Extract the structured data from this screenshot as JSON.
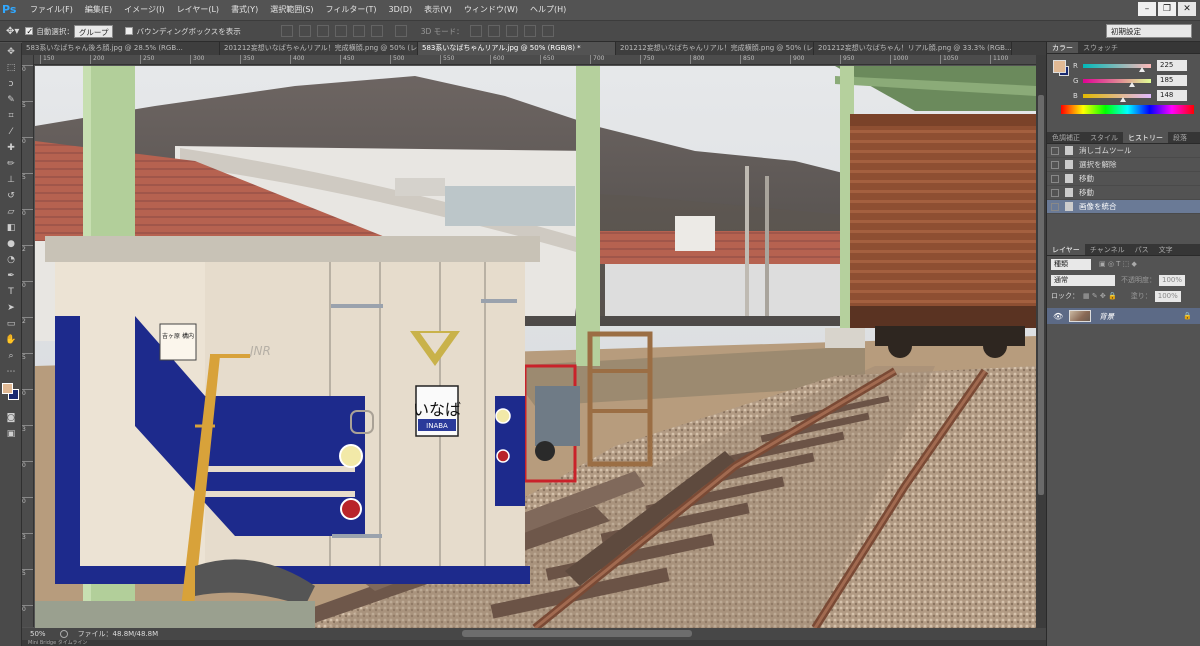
{
  "app": {
    "logo": "Ps"
  },
  "menu": [
    "ファイル(F)",
    "編集(E)",
    "イメージ(I)",
    "レイヤー(L)",
    "書式(Y)",
    "選択範囲(S)",
    "フィルター(T)",
    "3D(D)",
    "表示(V)",
    "ウィンドウ(W)",
    "ヘルプ(H)"
  ],
  "window_buttons": [
    "–",
    "❐",
    "✕"
  ],
  "options": {
    "auto_select_label": "自動選択：",
    "auto_select_value": "グループ",
    "bounding_box_label": "バウンディングボックスを表示",
    "mode_3d_label": "3D モード：",
    "workspace": "初期設定"
  },
  "tabs": [
    "583系いなばちゃん後ろ顔.jpg @ 28.5% (RGB...",
    "201212妄想いなばちゃんリアル！完成横顔.png @ 50% (レイ...",
    "583系いなばちゃんリアル.jpg @ 50% (RGB/8) *",
    "201212妄想いなばちゃんリアル！完成横顔.png @ 50% (レイヤ...",
    "201212妄想いなばちゃん！リアル顔.png @ 33.3% (RGB..."
  ],
  "active_tab": 2,
  "ruler_h": [
    "150",
    "200",
    "250",
    "300",
    "350",
    "400",
    "450",
    "500",
    "550",
    "600",
    "650",
    "700",
    "750",
    "800",
    "850",
    "900",
    "950",
    "1000",
    "1050",
    "1100"
  ],
  "ruler_v": [
    "0",
    "5",
    "0",
    "5",
    "0",
    "2",
    "0",
    "2",
    "5",
    "0",
    "3",
    "0",
    "0",
    "3",
    "5",
    "0"
  ],
  "canvas_text": {
    "destination_sign": "いなば",
    "destination_romaji": "INABA",
    "jnr_logo": "JNR",
    "poster": "吉ヶ原 構内"
  },
  "status": {
    "zoom": "50%",
    "file_info": "ファイル：48.8M/48.8M"
  },
  "bottom_tabs": "Mini Bridge  タイムライン",
  "color_panel": {
    "tabs": [
      "カラー",
      "スウォッチ"
    ],
    "channels": [
      {
        "label": "R",
        "value": "225",
        "gradient": "#00b9b9,#ffb9b9"
      },
      {
        "label": "G",
        "value": "185",
        "gradient": "#e10094,#e1ff94"
      },
      {
        "label": "B",
        "value": "148",
        "gradient": "#e1b900,#e1b9ff"
      }
    ]
  },
  "history_panel": {
    "tabs": [
      "色調補正",
      "スタイル",
      "ヒストリー",
      "段落"
    ],
    "active_tab": 2,
    "items": [
      "消しゴムツール",
      "選択を解除",
      "移動",
      "移動",
      "画像を統合"
    ],
    "selected": 4
  },
  "layers_panel": {
    "tabs": [
      "レイヤー",
      "チャンネル",
      "パス",
      "文字"
    ],
    "kind_label": "種類",
    "blend_mode": "通常",
    "opacity_label": "不透明度：",
    "opacity_value": "100%",
    "lock_label": "ロック：",
    "fill_label": "塗り：",
    "fill_value": "100%",
    "layers": [
      {
        "name": "背景"
      }
    ]
  }
}
